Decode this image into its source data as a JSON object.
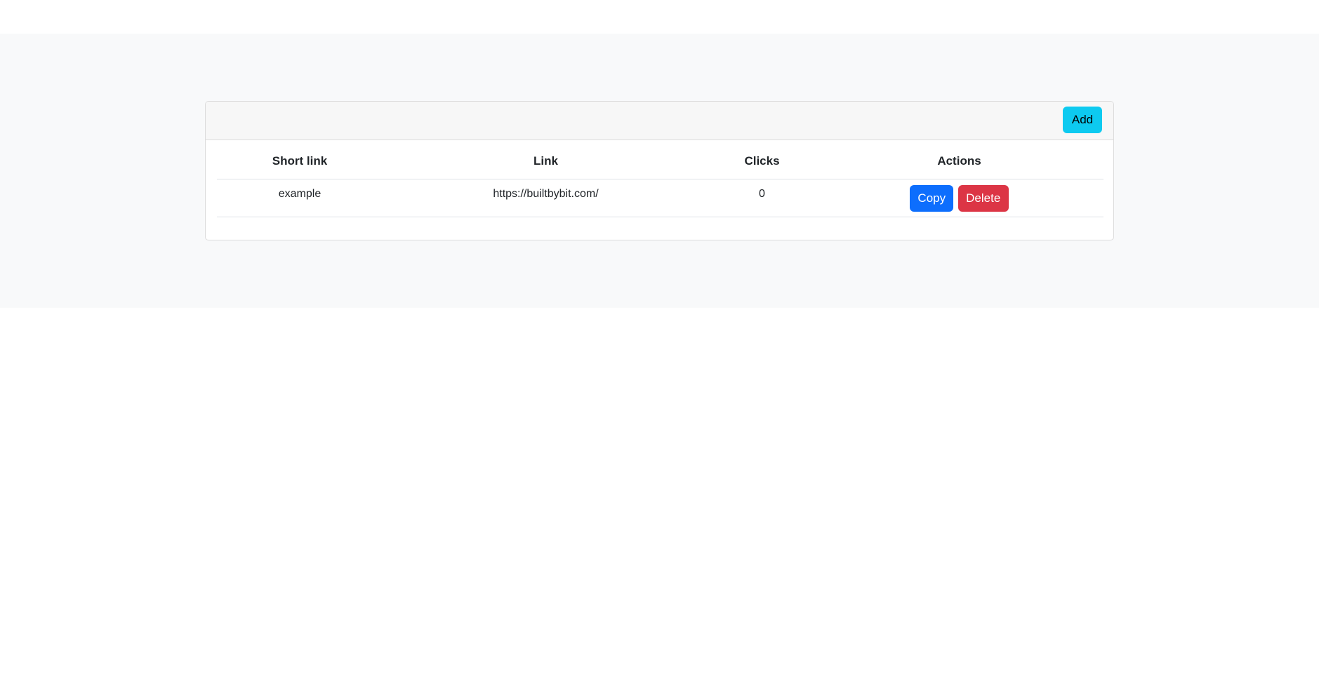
{
  "header": {
    "add_label": "Add"
  },
  "table": {
    "columns": [
      "Short link",
      "Link",
      "Clicks",
      "Actions"
    ],
    "rows": [
      {
        "short_link": "example",
        "link": "https://builtbybit.com/",
        "clicks": "0",
        "copy_label": "Copy",
        "delete_label": "Delete"
      }
    ]
  },
  "colors": {
    "add_button": "#0dcaf0",
    "copy_button": "#0d6efd",
    "delete_button": "#dc3545",
    "band_background": "#f8f9fa",
    "header_background": "#f7f7f7"
  }
}
